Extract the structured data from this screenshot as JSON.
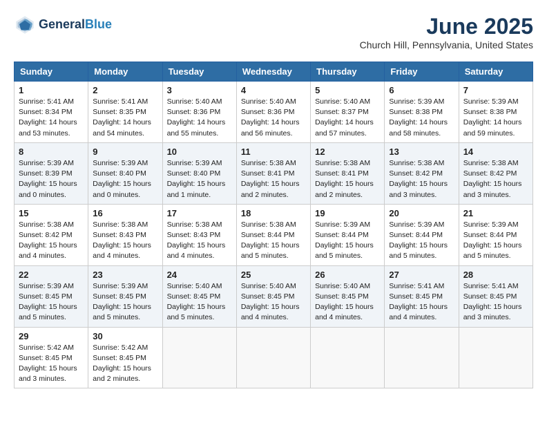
{
  "logo": {
    "line1": "General",
    "line2": "Blue"
  },
  "title": "June 2025",
  "location": "Church Hill, Pennsylvania, United States",
  "headers": [
    "Sunday",
    "Monday",
    "Tuesday",
    "Wednesday",
    "Thursday",
    "Friday",
    "Saturday"
  ],
  "weeks": [
    [
      {
        "day": "1",
        "info": "Sunrise: 5:41 AM\nSunset: 8:34 PM\nDaylight: 14 hours\nand 53 minutes."
      },
      {
        "day": "2",
        "info": "Sunrise: 5:41 AM\nSunset: 8:35 PM\nDaylight: 14 hours\nand 54 minutes."
      },
      {
        "day": "3",
        "info": "Sunrise: 5:40 AM\nSunset: 8:36 PM\nDaylight: 14 hours\nand 55 minutes."
      },
      {
        "day": "4",
        "info": "Sunrise: 5:40 AM\nSunset: 8:36 PM\nDaylight: 14 hours\nand 56 minutes."
      },
      {
        "day": "5",
        "info": "Sunrise: 5:40 AM\nSunset: 8:37 PM\nDaylight: 14 hours\nand 57 minutes."
      },
      {
        "day": "6",
        "info": "Sunrise: 5:39 AM\nSunset: 8:38 PM\nDaylight: 14 hours\nand 58 minutes."
      },
      {
        "day": "7",
        "info": "Sunrise: 5:39 AM\nSunset: 8:38 PM\nDaylight: 14 hours\nand 59 minutes."
      }
    ],
    [
      {
        "day": "8",
        "info": "Sunrise: 5:39 AM\nSunset: 8:39 PM\nDaylight: 15 hours\nand 0 minutes."
      },
      {
        "day": "9",
        "info": "Sunrise: 5:39 AM\nSunset: 8:40 PM\nDaylight: 15 hours\nand 0 minutes."
      },
      {
        "day": "10",
        "info": "Sunrise: 5:39 AM\nSunset: 8:40 PM\nDaylight: 15 hours\nand 1 minute."
      },
      {
        "day": "11",
        "info": "Sunrise: 5:38 AM\nSunset: 8:41 PM\nDaylight: 15 hours\nand 2 minutes."
      },
      {
        "day": "12",
        "info": "Sunrise: 5:38 AM\nSunset: 8:41 PM\nDaylight: 15 hours\nand 2 minutes."
      },
      {
        "day": "13",
        "info": "Sunrise: 5:38 AM\nSunset: 8:42 PM\nDaylight: 15 hours\nand 3 minutes."
      },
      {
        "day": "14",
        "info": "Sunrise: 5:38 AM\nSunset: 8:42 PM\nDaylight: 15 hours\nand 3 minutes."
      }
    ],
    [
      {
        "day": "15",
        "info": "Sunrise: 5:38 AM\nSunset: 8:42 PM\nDaylight: 15 hours\nand 4 minutes."
      },
      {
        "day": "16",
        "info": "Sunrise: 5:38 AM\nSunset: 8:43 PM\nDaylight: 15 hours\nand 4 minutes."
      },
      {
        "day": "17",
        "info": "Sunrise: 5:38 AM\nSunset: 8:43 PM\nDaylight: 15 hours\nand 4 minutes."
      },
      {
        "day": "18",
        "info": "Sunrise: 5:38 AM\nSunset: 8:44 PM\nDaylight: 15 hours\nand 5 minutes."
      },
      {
        "day": "19",
        "info": "Sunrise: 5:39 AM\nSunset: 8:44 PM\nDaylight: 15 hours\nand 5 minutes."
      },
      {
        "day": "20",
        "info": "Sunrise: 5:39 AM\nSunset: 8:44 PM\nDaylight: 15 hours\nand 5 minutes."
      },
      {
        "day": "21",
        "info": "Sunrise: 5:39 AM\nSunset: 8:44 PM\nDaylight: 15 hours\nand 5 minutes."
      }
    ],
    [
      {
        "day": "22",
        "info": "Sunrise: 5:39 AM\nSunset: 8:45 PM\nDaylight: 15 hours\nand 5 minutes."
      },
      {
        "day": "23",
        "info": "Sunrise: 5:39 AM\nSunset: 8:45 PM\nDaylight: 15 hours\nand 5 minutes."
      },
      {
        "day": "24",
        "info": "Sunrise: 5:40 AM\nSunset: 8:45 PM\nDaylight: 15 hours\nand 5 minutes."
      },
      {
        "day": "25",
        "info": "Sunrise: 5:40 AM\nSunset: 8:45 PM\nDaylight: 15 hours\nand 4 minutes."
      },
      {
        "day": "26",
        "info": "Sunrise: 5:40 AM\nSunset: 8:45 PM\nDaylight: 15 hours\nand 4 minutes."
      },
      {
        "day": "27",
        "info": "Sunrise: 5:41 AM\nSunset: 8:45 PM\nDaylight: 15 hours\nand 4 minutes."
      },
      {
        "day": "28",
        "info": "Sunrise: 5:41 AM\nSunset: 8:45 PM\nDaylight: 15 hours\nand 3 minutes."
      }
    ],
    [
      {
        "day": "29",
        "info": "Sunrise: 5:42 AM\nSunset: 8:45 PM\nDaylight: 15 hours\nand 3 minutes."
      },
      {
        "day": "30",
        "info": "Sunrise: 5:42 AM\nSunset: 8:45 PM\nDaylight: 15 hours\nand 2 minutes."
      },
      {
        "day": "",
        "info": ""
      },
      {
        "day": "",
        "info": ""
      },
      {
        "day": "",
        "info": ""
      },
      {
        "day": "",
        "info": ""
      },
      {
        "day": "",
        "info": ""
      }
    ]
  ]
}
